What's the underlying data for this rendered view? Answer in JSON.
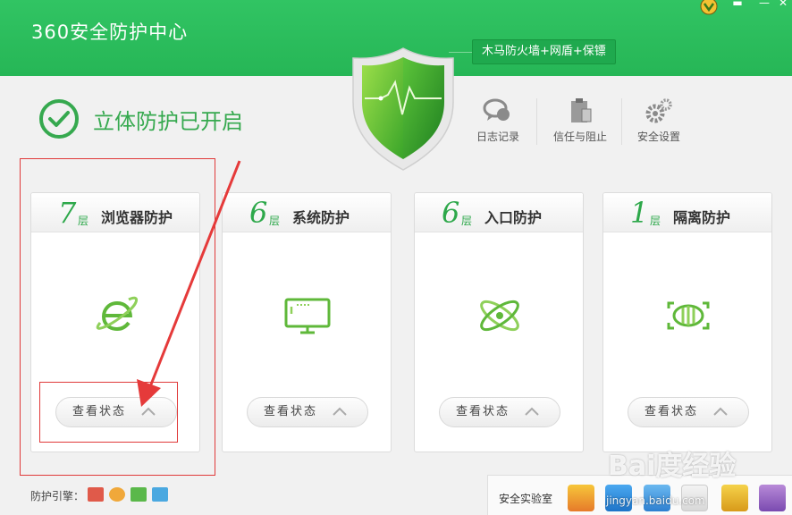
{
  "app": {
    "title": "360安全防护中心",
    "feature_tag": "木马防火墙+网盾+保镖"
  },
  "status": {
    "text": "立体防护已开启",
    "icon": "check-circle-icon"
  },
  "tools": [
    {
      "label": "日志记录",
      "icon": "log-chat-icon"
    },
    {
      "label": "信任与阻止",
      "icon": "clipboard-icon"
    },
    {
      "label": "安全设置",
      "icon": "gear-icon"
    }
  ],
  "cards": [
    {
      "num": "7",
      "layer": "层",
      "title": "浏览器防护",
      "button": "查看状态",
      "icon": "browser-e-icon"
    },
    {
      "num": "6",
      "layer": "层",
      "title": "系统防护",
      "button": "查看状态",
      "icon": "monitor-icon"
    },
    {
      "num": "6",
      "layer": "层",
      "title": "入口防护",
      "button": "查看状态",
      "icon": "atom-icon"
    },
    {
      "num": "1",
      "layer": "层",
      "title": "隔离防护",
      "button": "查看状态",
      "icon": "isolation-icon"
    }
  ],
  "engines": {
    "label": "防护引擎：",
    "icons": [
      "firewall-icon",
      "globe-icon",
      "user-icon",
      "mail-icon"
    ]
  },
  "lab": {
    "label": "安全实验室",
    "icons": [
      "app-icon",
      "settings-icon",
      "shield-icon",
      "medkit-icon",
      "folder-icon",
      "shredder-icon"
    ]
  },
  "watermark": {
    "text": "Bai度经验",
    "sub": "jingyan.baidu.com"
  },
  "colors": {
    "header": "#2cc05b",
    "accent": "#2da84a",
    "annotation": "#e03a3a"
  }
}
